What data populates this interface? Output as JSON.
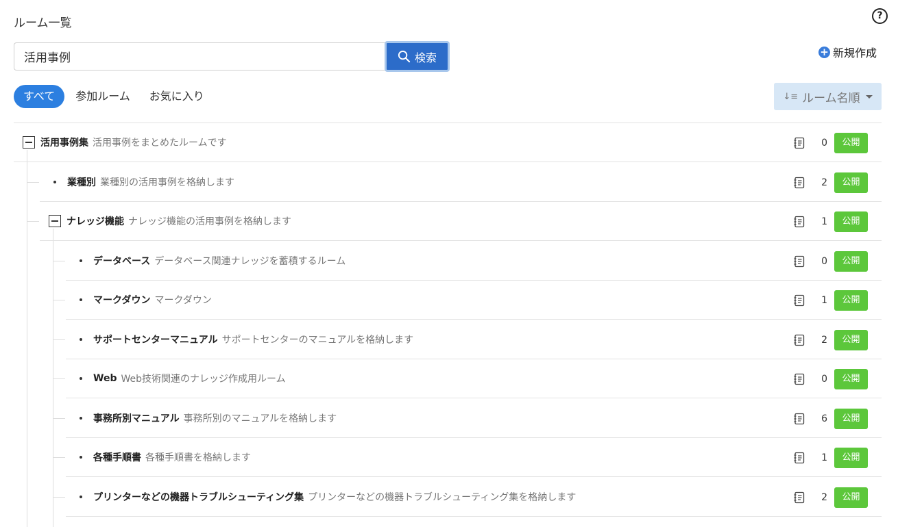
{
  "header": {
    "title": "ルーム一覧",
    "help_label": "?"
  },
  "search": {
    "value": "活用事例",
    "placeholder": "",
    "button_label": "検索"
  },
  "new_button": {
    "label": "新規作成"
  },
  "tabs": [
    {
      "label": "すべて"
    },
    {
      "label": "参加ルーム"
    },
    {
      "label": "お気に入り"
    }
  ],
  "sort": {
    "label": "ルーム名順"
  },
  "badge_label": "公開",
  "rooms": [
    {
      "name": "活用事例集",
      "description": "活用事例をまとめたルームです",
      "count": "0"
    },
    {
      "name": "業種別",
      "description": "業種別の活用事例を格納します",
      "count": "2"
    },
    {
      "name": "ナレッジ機能",
      "description": "ナレッジ機能の活用事例を格納します",
      "count": "1"
    },
    {
      "name": "データベース",
      "description": "データベース関連ナレッジを蓄積するルーム",
      "count": "0"
    },
    {
      "name": "マークダウン",
      "description": "マークダウン",
      "count": "1"
    },
    {
      "name": "サポートセンターマニュアル",
      "description": "サポートセンターのマニュアルを格納します",
      "count": "2"
    },
    {
      "name": "Web",
      "description": "Web技術関連のナレッジ作成用ルーム",
      "count": "0"
    },
    {
      "name": "事務所別マニュアル",
      "description": "事務所別のマニュアルを格納します",
      "count": "6"
    },
    {
      "name": "各種手順書",
      "description": "各種手順書を格納します",
      "count": "1"
    },
    {
      "name": "プリンターなどの機器トラブルシューティング集",
      "description": "プリンターなどの機器トラブルシューティング集を格納します",
      "count": "2"
    }
  ]
}
